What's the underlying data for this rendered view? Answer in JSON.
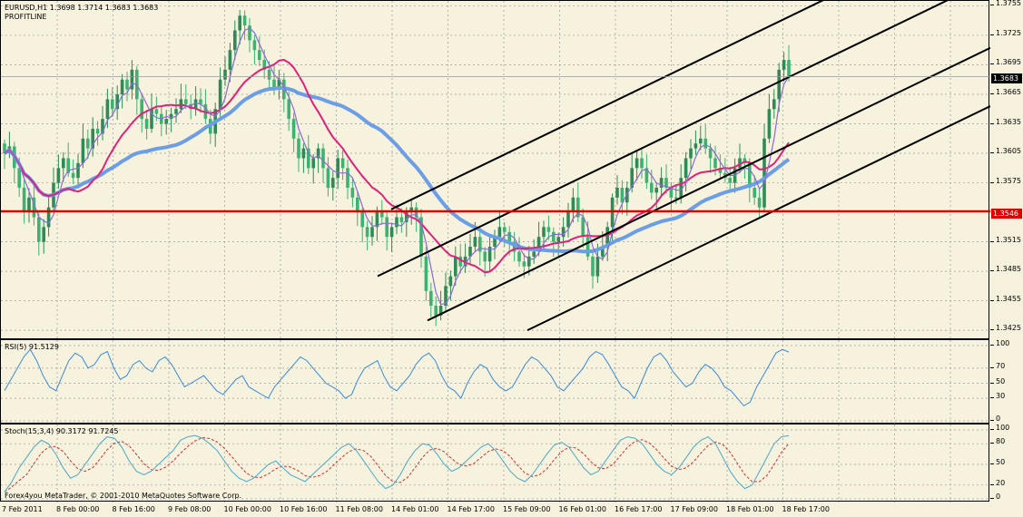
{
  "window": {
    "symbol_line": "EURUSD,H1  1.3698 1.3714 1.3683 1.3683",
    "indicator_name": "PROFITLINE",
    "copyright": "Forex4you MetaTrader, © 2001-2010 MetaQuotes Software Corp."
  },
  "colors": {
    "background": "#f6f2dd",
    "grid": "#999999",
    "bull_candle": "#2e8b57",
    "bear_candle": "#3cb371",
    "ma_fast": "#8a6bd6",
    "ma_mid": "#e0207a",
    "ma_slow": "#6b9ee6",
    "support_line": "#e00000",
    "channel": "#000000",
    "rsi_line": "#3a8bd6",
    "stoch_main": "#4aa8c8",
    "stoch_signal": "#d33030"
  },
  "price_axis": {
    "ticks": [
      "1.3755",
      "1.3725",
      "1.3695",
      "1.3665",
      "1.3635",
      "1.3605",
      "1.3575",
      "1.3515",
      "1.3485",
      "1.3455",
      "1.3425"
    ],
    "current_price": "1.3683",
    "line_price": "1.3546"
  },
  "rsi": {
    "title": "RSI(5) 91.5129",
    "ticks": [
      "100",
      "70",
      "50",
      "30",
      "0"
    ]
  },
  "stoch": {
    "title": "Stoch(15,3,4) 90.3172 91.7245",
    "ticks": [
      "100",
      "80",
      "50",
      "20",
      "0"
    ]
  },
  "time_axis": {
    "labels": [
      "7 Feb 2011",
      "8 Feb 00:00",
      "8 Feb 16:00",
      "9 Feb 08:00",
      "10 Feb 00:00",
      "10 Feb 16:00",
      "11 Feb 08:00",
      "14 Feb 01:00",
      "14 Feb 17:00",
      "15 Feb 09:00",
      "16 Feb 01:00",
      "16 Feb 17:00",
      "17 Feb 09:00",
      "18 Feb 01:00",
      "18 Feb 17:00"
    ]
  },
  "chart_data": {
    "type": "candlestick",
    "symbol": "EURUSD",
    "timeframe": "H1",
    "ylim": [
      1.3415,
      1.376
    ],
    "last_bar": {
      "open": 1.3698,
      "high": 1.3714,
      "low": 1.3683,
      "close": 1.3683
    },
    "closes": [
      1.3605,
      1.3612,
      1.359,
      1.357,
      1.3545,
      1.356,
      1.354,
      1.3515,
      1.353,
      1.355,
      1.3575,
      1.359,
      1.36,
      1.3585,
      1.358,
      1.3595,
      1.362,
      1.361,
      1.363,
      1.3625,
      1.364,
      1.366,
      1.365,
      1.3665,
      1.368,
      1.367,
      1.369,
      1.366,
      1.364,
      1.363,
      1.365,
      1.3645,
      1.3635,
      1.364,
      1.3645,
      1.365,
      1.366,
      1.3655,
      1.365,
      1.366,
      1.3655,
      1.364,
      1.3625,
      1.365,
      1.368,
      1.369,
      1.371,
      1.373,
      1.3745,
      1.3735,
      1.372,
      1.371,
      1.37,
      1.369,
      1.368,
      1.367,
      1.368,
      1.366,
      1.364,
      1.362,
      1.36,
      1.361,
      1.359,
      1.36,
      1.361,
      1.359,
      1.357,
      1.358,
      1.36,
      1.359,
      1.357,
      1.356,
      1.3545,
      1.353,
      1.352,
      1.353,
      1.3545,
      1.354,
      1.352,
      1.353,
      1.354,
      1.3535,
      1.3545,
      1.355,
      1.354,
      1.35,
      1.3465,
      1.345,
      1.344,
      1.345,
      1.347,
      1.348,
      1.35,
      1.349,
      1.35,
      1.351,
      1.352,
      1.3505,
      1.3495,
      1.351,
      1.352,
      1.353,
      1.3525,
      1.3515,
      1.3505,
      1.3495,
      1.349,
      1.35,
      1.3505,
      1.352,
      1.353,
      1.3525,
      1.3515,
      1.352,
      1.353,
      1.3545,
      1.356,
      1.354,
      1.352,
      1.35,
      1.348,
      1.35,
      1.351,
      1.353,
      1.356,
      1.357,
      1.3555,
      1.357,
      1.359,
      1.36,
      1.359,
      1.3575,
      1.3565,
      1.357,
      1.358,
      1.357,
      1.356,
      1.356,
      1.358,
      1.36,
      1.361,
      1.3615,
      1.362,
      1.361,
      1.36,
      1.359,
      1.3585,
      1.358,
      1.3575,
      1.359,
      1.36,
      1.3595,
      1.357,
      1.356,
      1.355,
      1.362,
      1.365,
      1.366,
      1.369,
      1.37,
      1.3683
    ],
    "moving_averages": [
      "fast",
      "mid",
      "slow"
    ],
    "horizontal_line": 1.3546,
    "channels": 4,
    "rsi_values": [
      40,
      55,
      70,
      85,
      95,
      80,
      60,
      45,
      40,
      60,
      80,
      90,
      85,
      70,
      75,
      88,
      92,
      70,
      55,
      60,
      75,
      80,
      70,
      65,
      80,
      85,
      75,
      60,
      45,
      50,
      55,
      60,
      50,
      40,
      35,
      45,
      55,
      60,
      45,
      40,
      35,
      30,
      45,
      55,
      65,
      75,
      85,
      80,
      70,
      60,
      50,
      45,
      40,
      30,
      35,
      55,
      70,
      75,
      80,
      60,
      45,
      40,
      50,
      60,
      75,
      85,
      90,
      80,
      60,
      45,
      40,
      30,
      50,
      65,
      75,
      70,
      55,
      45,
      40,
      45,
      60,
      75,
      85,
      80,
      70,
      60,
      45,
      40,
      50,
      60,
      70,
      85,
      92,
      88,
      75,
      60,
      45,
      40,
      30,
      50,
      70,
      85,
      90,
      80,
      65,
      55,
      45,
      50,
      65,
      75,
      70,
      60,
      45,
      40,
      30,
      20,
      25,
      45,
      60,
      75,
      90,
      95,
      91.5
    ],
    "stoch_values": [
      10,
      25,
      45,
      60,
      75,
      85,
      80,
      65,
      45,
      30,
      35,
      50,
      65,
      80,
      90,
      88,
      75,
      55,
      40,
      35,
      40,
      50,
      60,
      70,
      85,
      90,
      92,
      88,
      80,
      70,
      55,
      40,
      30,
      25,
      30,
      40,
      50,
      55,
      45,
      35,
      30,
      25,
      35,
      45,
      55,
      65,
      75,
      80,
      70,
      55,
      40,
      25,
      15,
      20,
      35,
      55,
      70,
      80,
      78,
      65,
      50,
      40,
      45,
      55,
      65,
      75,
      80,
      70,
      55,
      40,
      30,
      25,
      35,
      50,
      65,
      78,
      82,
      75,
      60,
      45,
      35,
      40,
      55,
      70,
      85,
      90,
      88,
      80,
      65,
      50,
      40,
      35,
      45,
      60,
      75,
      85,
      90,
      80,
      60,
      40,
      25,
      15,
      20,
      40,
      60,
      80,
      90,
      91.7
    ]
  }
}
